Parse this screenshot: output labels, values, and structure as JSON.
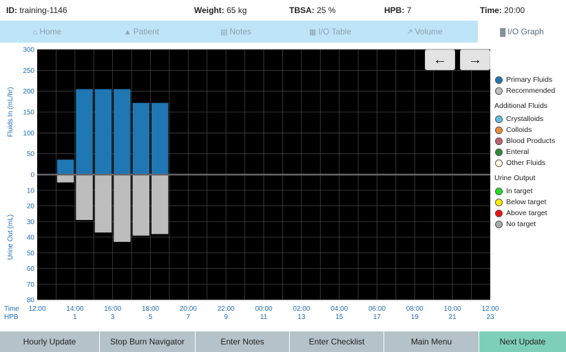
{
  "info": {
    "id_label": "ID:",
    "id_value": "training-1146",
    "weight_label": "Weight:",
    "weight_value": "65 kg",
    "tbsa_label": "TBSA:",
    "tbsa_value": "25 %",
    "hpb_label": "HPB:",
    "hpb_value": "7",
    "time_label": "Time:",
    "time_value": "20:00"
  },
  "nav": {
    "tabs": [
      {
        "label": "Home",
        "icon": "home-icon",
        "glyph": "⌂"
      },
      {
        "label": "Patient",
        "icon": "user-icon",
        "glyph": "▲"
      },
      {
        "label": "Notes",
        "icon": "file-icon",
        "glyph": "▤"
      },
      {
        "label": "I/O Table",
        "icon": "table-icon",
        "glyph": "▦"
      },
      {
        "label": "Volume",
        "icon": "area-chart-icon",
        "glyph": "↗"
      },
      {
        "label": "I/O Graph",
        "icon": "bar-chart-icon",
        "glyph": "▓"
      }
    ],
    "active": "I/O Graph"
  },
  "arrows": {
    "left": "←",
    "right": "→"
  },
  "legend": {
    "items": [
      {
        "label": "Primary Fluids",
        "color": "#1f77b4"
      },
      {
        "label": "Recommended",
        "color": "#bdbdbd"
      }
    ],
    "additional_header": "Additional Fluids",
    "additional": [
      {
        "label": "Crystalloids",
        "color": "#5bc0de"
      },
      {
        "label": "Colloids",
        "color": "#ef8a3c"
      },
      {
        "label": "Blood Products",
        "color": "#c0606e"
      },
      {
        "label": "Enteral",
        "color": "#2e8b3a"
      },
      {
        "label": "Other Fluids",
        "color": "#fffce0"
      }
    ],
    "urine_header": "Urine Output",
    "urine": [
      {
        "label": "In target",
        "color": "#22dd22"
      },
      {
        "label": "Below target",
        "color": "#ffee00"
      },
      {
        "label": "Above target",
        "color": "#ee1111"
      },
      {
        "label": "No target",
        "color": "#aaaaaa"
      }
    ]
  },
  "footer": {
    "buttons": [
      "Hourly Update",
      "Stop Burn Navigator",
      "Enter Notes",
      "Enter Checklist",
      "Main Menu",
      "Next Update"
    ]
  },
  "chart_data": {
    "type": "bar",
    "top_ylabel": "Fluids In (mL/hr)",
    "bottom_ylabel": "Urine Out (mL)",
    "top_ylim": [
      0,
      300
    ],
    "top_ticks": [
      0,
      50,
      100,
      150,
      200,
      250,
      300
    ],
    "bottom_ylim": [
      0,
      80
    ],
    "bottom_ticks": [
      0,
      10,
      20,
      30,
      40,
      50,
      60,
      70,
      80
    ],
    "hours": 24,
    "x_row_label": "Time",
    "hpb_row_label": "HPB",
    "time_ticks": [
      "12:00",
      "14:00",
      "16:00",
      "18:00",
      "20:00",
      "22:00",
      "00:00",
      "02:00",
      "04:00",
      "06:00",
      "08:00",
      "10:00",
      "12:00"
    ],
    "hpb_ticks": [
      "",
      "1",
      "3",
      "5",
      "7",
      "9",
      "11",
      "13",
      "15",
      "17",
      "19",
      "21",
      "23"
    ],
    "grid": true,
    "background": "#000000",
    "fluid_color": "#1f77b4",
    "urine_color": "#bdbdbd",
    "bars": [
      {
        "hpb": 1,
        "fluids_in": 36,
        "urine_out": 5
      },
      {
        "hpb": 2,
        "fluids_in": 205,
        "urine_out": 29
      },
      {
        "hpb": 3,
        "fluids_in": 205,
        "urine_out": 37
      },
      {
        "hpb": 4,
        "fluids_in": 205,
        "urine_out": 43
      },
      {
        "hpb": 5,
        "fluids_in": 172,
        "urine_out": 39
      },
      {
        "hpb": 6,
        "fluids_in": 172,
        "urine_out": 38
      }
    ]
  }
}
